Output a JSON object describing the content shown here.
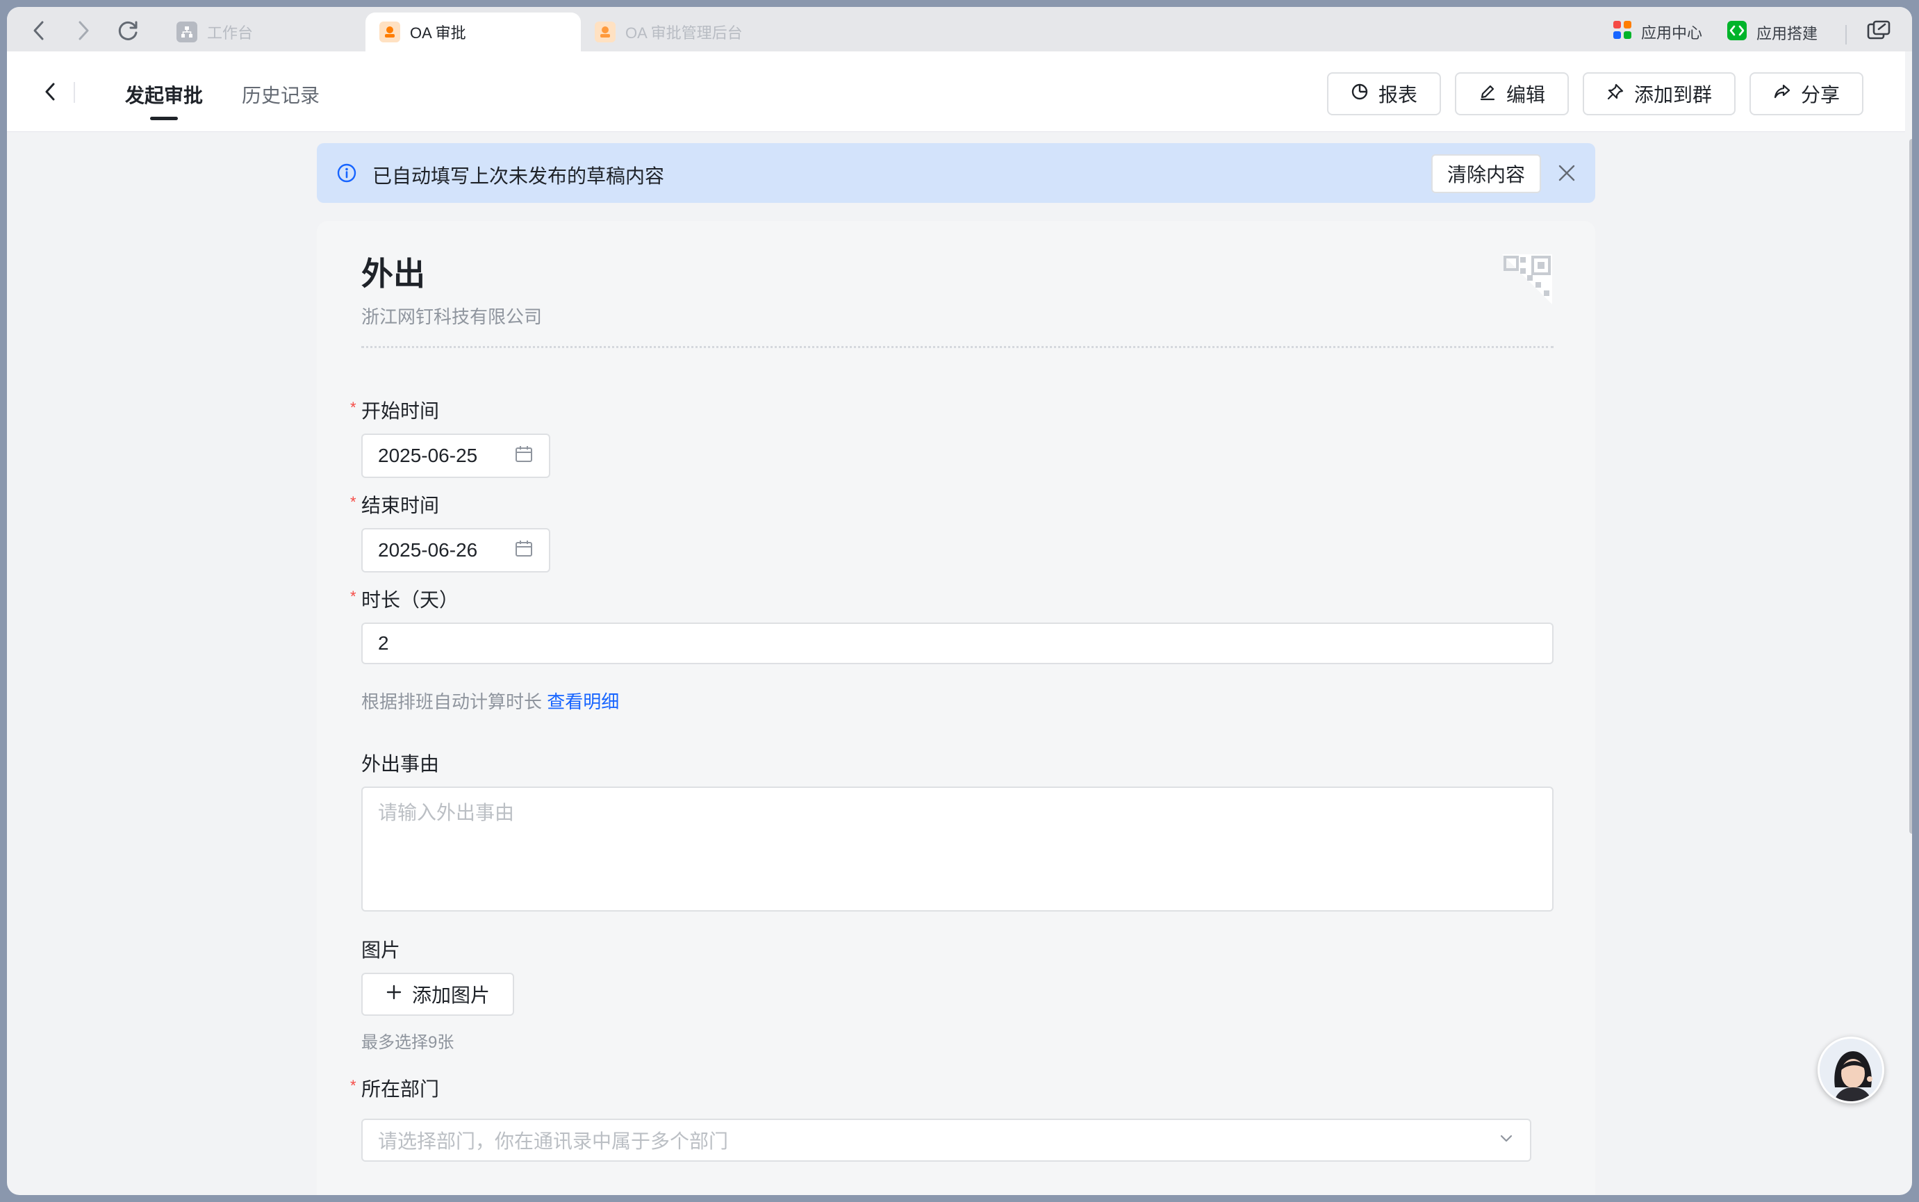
{
  "tabs": [
    {
      "label": "工作台",
      "icon": "org-icon"
    },
    {
      "label": "OA 审批",
      "icon": "approval-app-icon"
    },
    {
      "label": "OA 审批管理后台",
      "icon": "approval-app-icon"
    }
  ],
  "topbar": {
    "app_center": "应用中心",
    "app_builder": "应用搭建"
  },
  "header": {
    "tab_active": "发起审批",
    "tab_history": "历史记录",
    "report": "报表",
    "edit": "编辑",
    "add_to_group": "添加到群",
    "share": "分享"
  },
  "banner": {
    "text": "已自动填写上次未发布的草稿内容",
    "clear": "清除内容"
  },
  "form": {
    "title": "外出",
    "company": "浙江网钉科技有限公司",
    "start_label": "开始时间",
    "start_value": "2025-06-25",
    "end_label": "结束时间",
    "end_value": "2025-06-26",
    "duration_label": "时长（天）",
    "duration_value": "2",
    "duration_hint": "根据排班自动计算时长",
    "duration_link": "查看明细",
    "reason_label": "外出事由",
    "reason_placeholder": "请输入外出事由",
    "image_label": "图片",
    "add_image": "添加图片",
    "image_hint": "最多选择9张",
    "dept_label": "所在部门",
    "dept_placeholder": "请选择部门，你在通讯录中属于多个部门",
    "required_mark": "*"
  },
  "colors": {
    "accent": "#1664ff",
    "required": "#f54a45",
    "banner_bg": "#d3e3fb"
  }
}
